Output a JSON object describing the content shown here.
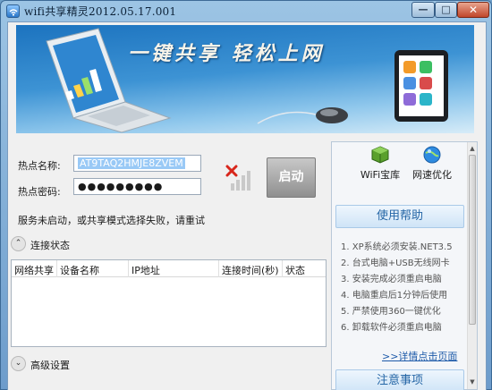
{
  "window": {
    "title": "wifi共享精灵2012.05.17.001",
    "min_label": "—",
    "max_label": "□",
    "close_label": "✕"
  },
  "banner": {
    "slogan": "一键共享  轻松上网"
  },
  "form": {
    "ssid_label": "热点名称:",
    "ssid_value": "AT9TAQ2HMJE8ZVEM",
    "password_label": "热点密码:",
    "password_value": "●●●●●●●●●",
    "start_label": "启动",
    "status_message": "服务未启动，或共享模式选择失败，请重试"
  },
  "connection": {
    "header": "连接状态",
    "columns": [
      "网络共享",
      "设备名称",
      "IP地址",
      "连接时间(秒)",
      "状态"
    ]
  },
  "advanced": {
    "header": "高级设置"
  },
  "right_panel": {
    "tools": [
      {
        "label": "WiFi宝库",
        "icon": "wifi-treasure-box-icon"
      },
      {
        "label": "网速优化",
        "icon": "speed-optimize-globe-icon"
      }
    ],
    "help_header": "使用帮助",
    "tips": [
      "1. XP系统必须安装.NET3.5",
      "2. 台式电脑+USB无线网卡",
      "3. 安装完成必须重启电脑",
      "4. 电脑重启后1分钟后使用",
      "5. 严禁使用360一键优化",
      "6. 卸载软件必须重启电脑"
    ],
    "more_link": ">>详情点击页面",
    "notice_header": "注意事项"
  },
  "colors": {
    "accent": "#2566a6",
    "title_bar": "#9cc4e4",
    "link": "#1d5aa9",
    "error_x": "#d8261b"
  }
}
